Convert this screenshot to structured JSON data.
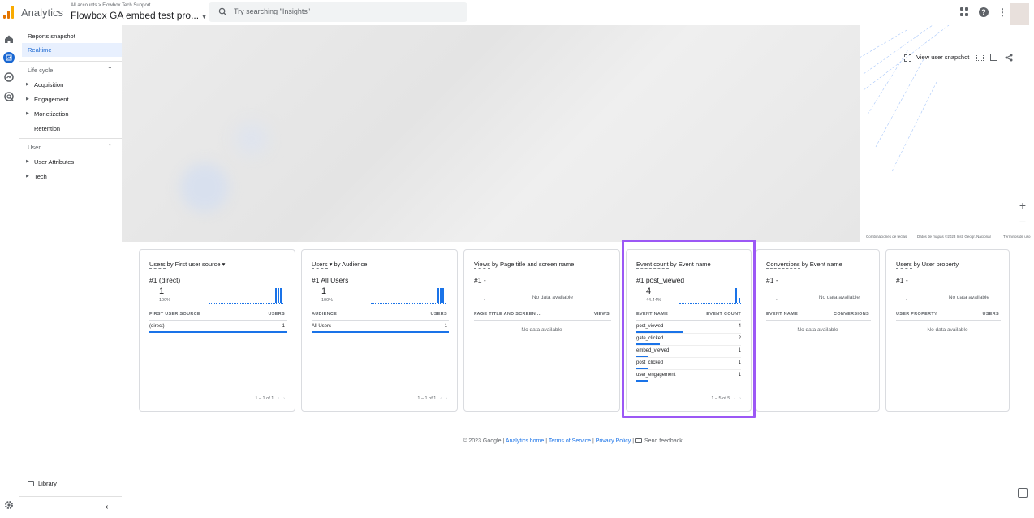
{
  "header": {
    "app_name": "Analytics",
    "breadcrumb": "All accounts > Flowbox Tech Support",
    "property": "Flowbox GA embed test pro...",
    "search_placeholder": "Try searching \"Insights\""
  },
  "sidenav": {
    "reports_snapshot": "Reports snapshot",
    "realtime": "Realtime",
    "lifecycle_header": "Life cycle",
    "lifecycle_items": [
      "Acquisition",
      "Engagement",
      "Monetization",
      "Retention"
    ],
    "user_header": "User",
    "user_items": [
      "User Attributes",
      "Tech"
    ],
    "library": "Library"
  },
  "map": {
    "view_user_snapshot": "View user snapshot",
    "footer_shortcuts": "Combinaciones de teclas",
    "footer_mapdata": "Datos de mapas ©2023 Inst. Geogr. Nacional",
    "footer_terms": "Términos de uso"
  },
  "cards": [
    {
      "title_dim": "Users",
      "title_rest": " by First user source",
      "rank": "#1  (direct)",
      "big": "1",
      "pct": "100%",
      "col_left": "FIRST USER SOURCE",
      "col_right": "USERS",
      "rows": [
        {
          "label": "(direct)",
          "value": "1"
        }
      ],
      "pager": "1 – 1 of 1"
    },
    {
      "title_dim": "Users",
      "title_rest": " by Audience",
      "rank": "#1  All Users",
      "big": "1",
      "pct": "100%",
      "col_left": "AUDIENCE",
      "col_right": "USERS",
      "rows": [
        {
          "label": "All Users",
          "value": "1"
        }
      ],
      "pager": "1 – 1 of 1"
    },
    {
      "title_dim": "Views",
      "title_rest": " by Page title and screen name",
      "rank": "#1  -",
      "no_data_top": "No data available",
      "dash": "-",
      "col_left": "PAGE TITLE AND SCREEN ...",
      "col_right": "VIEWS",
      "no_data_mid": "No data available"
    },
    {
      "title_dim": "Event count",
      "title_rest": " by Event name",
      "rank": "#1  post_viewed",
      "big": "4",
      "pct": "44.44%",
      "col_left": "EVENT NAME",
      "col_right": "EVENT COUNT",
      "rows": [
        {
          "label": "post_viewed",
          "value": "4"
        },
        {
          "label": "gate_clicked",
          "value": "2"
        },
        {
          "label": "embed_viewed",
          "value": "1"
        },
        {
          "label": "post_clicked",
          "value": "1"
        },
        {
          "label": "user_engagement",
          "value": "1"
        }
      ],
      "pager": "1 – 5 of 5"
    },
    {
      "title_dim": "Conversions",
      "title_rest": " by Event name",
      "rank": "#1  -",
      "no_data_top": "No data available",
      "dash": "-",
      "col_left": "EVENT NAME",
      "col_right": "CONVERSIONS",
      "no_data_mid": "No data available"
    },
    {
      "title_dim": "Users",
      "title_rest": " by User property",
      "rank": "#1  -",
      "no_data_top": "No data available",
      "dash": "-",
      "col_left": "USER PROPERTY",
      "col_right": "USERS",
      "no_data_mid": "No data available"
    }
  ],
  "footer": {
    "copyright": "© 2023 Google |",
    "analytics_home": "Analytics home",
    "terms": "Terms of Service",
    "privacy": "Privacy Policy",
    "feedback": "Send feedback"
  },
  "colors": {
    "accent": "#1a73e8",
    "highlight": "#9c58f5",
    "logo_orange": "#f9ab00"
  }
}
